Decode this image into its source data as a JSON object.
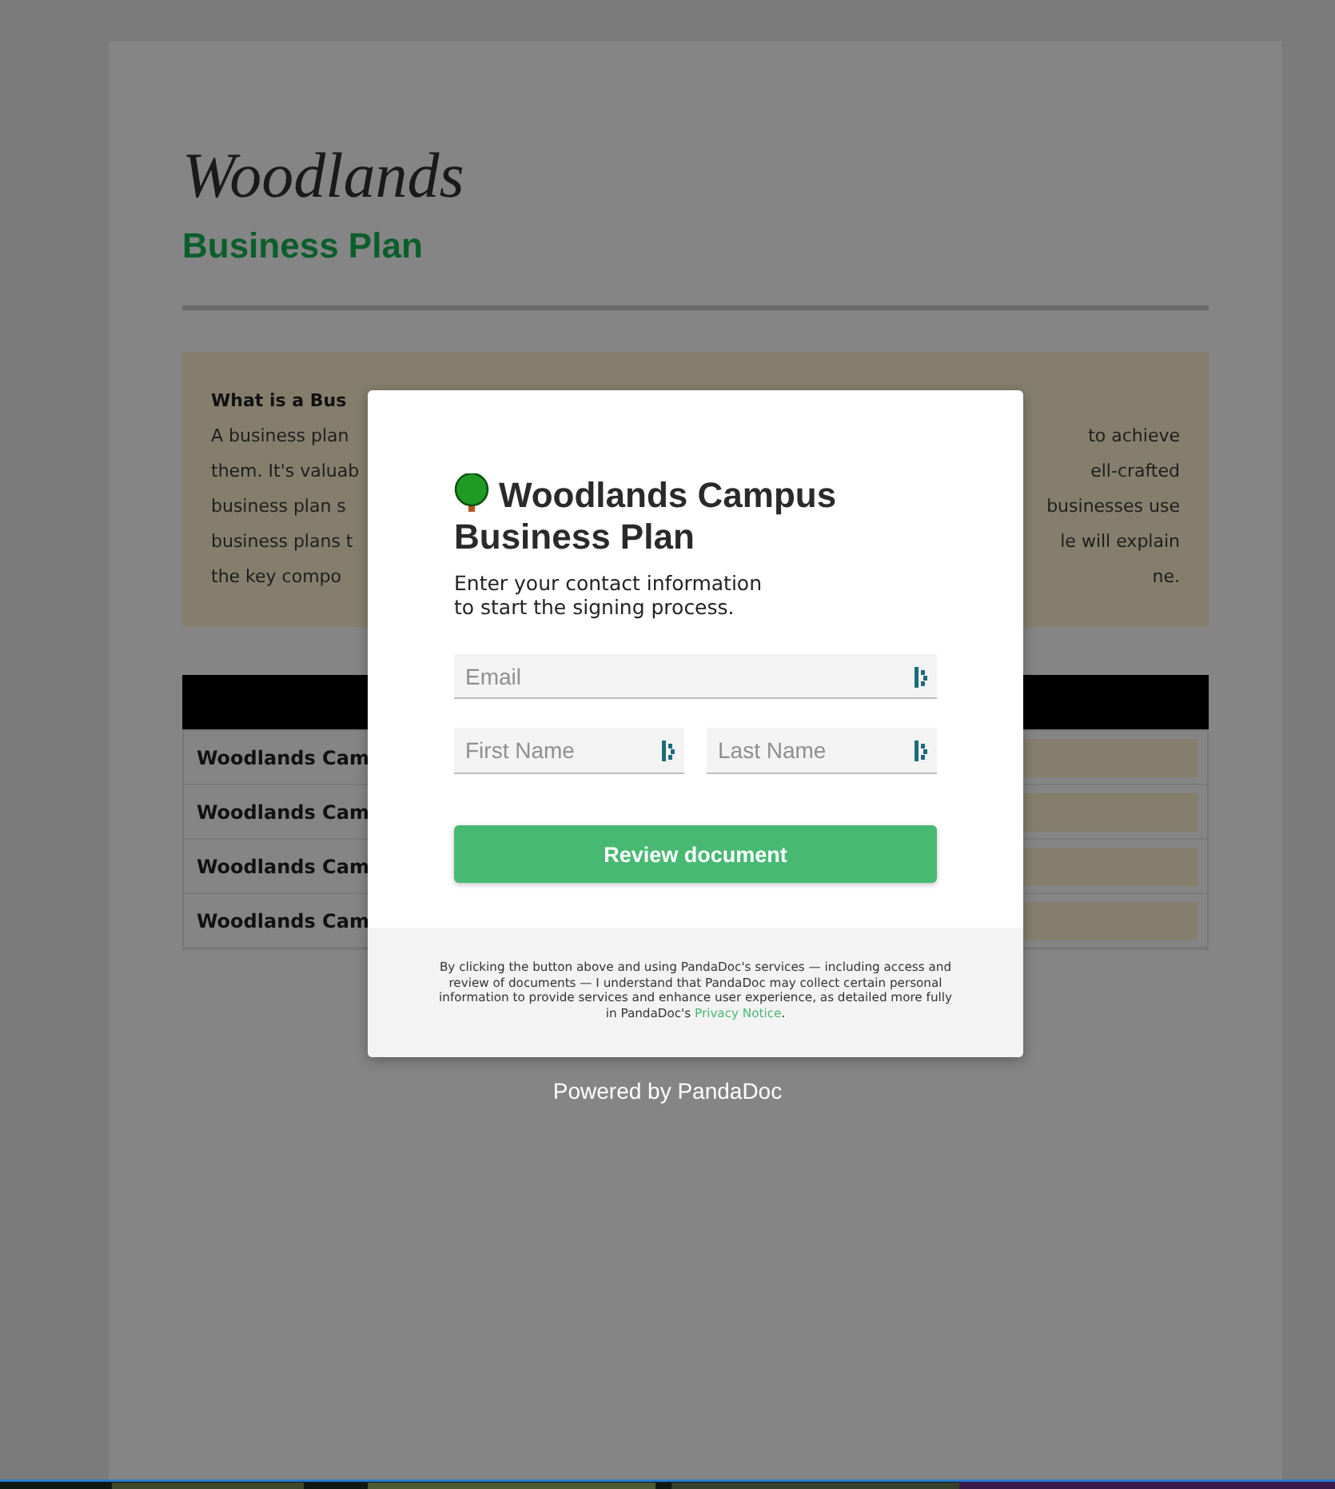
{
  "document": {
    "logo": "Woodlands",
    "title": "Business Plan",
    "callout": {
      "heading": "What is a Bus",
      "left_lines": [
        "A business plan",
        "them. It's valuab",
        "business plan s",
        "business plans t",
        "the key compo"
      ],
      "right_lines": [
        "to achieve",
        "ell-crafted",
        "businesses use",
        "le will explain",
        "ne."
      ]
    },
    "rows": [
      "Woodlands Cam",
      "Woodlands Cam",
      "Woodlands Cam",
      "Woodlands Cam"
    ]
  },
  "dialog": {
    "title": "Woodlands Campus Business Plan",
    "subtitle_lines": [
      "Enter your contact information",
      "to start the signing process."
    ],
    "fields": [
      {
        "placeholder": "Email"
      },
      {
        "placeholder": "First Name"
      },
      {
        "placeholder": "Last Name"
      }
    ],
    "button": "Review document",
    "consent": {
      "text": "By clicking the button above and using PandaDoc's services — including access and review of documents — I understand that PandaDoc may collect certain personal information to provide services and enhance user experience, as detailed more fully in PandaDoc's ",
      "link": "Privacy Notice",
      "after": "."
    }
  },
  "powered_by": "Powered by PandaDoc"
}
